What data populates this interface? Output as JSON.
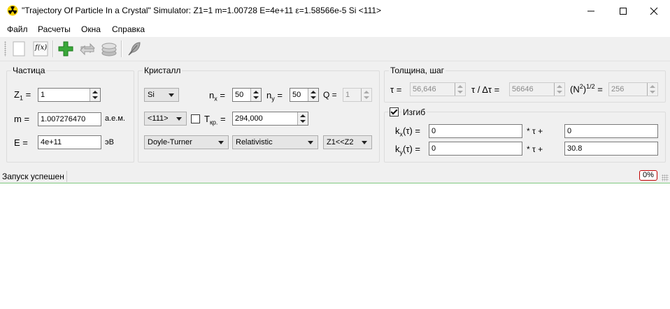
{
  "window": {
    "title": "\"Trajectory Of Particle In a Crystal\" Simulator: Z1=1 m=1.00728 E=4e+11 ε=1.58566e-5 Si <111>",
    "controls": [
      "minimize",
      "maximize",
      "close"
    ]
  },
  "menu": {
    "items": [
      "Файл",
      "Расчеты",
      "Окна",
      "Справка"
    ]
  },
  "toolbar": {
    "buttons": [
      "new-document-icon",
      "function-fx-icon",
      "add-plus-icon",
      "swap-arrows-icon",
      "layers-stack-icon",
      "feather-icon"
    ],
    "fx_label": "f(x)"
  },
  "particle": {
    "title": "Частица",
    "z_label": "Z",
    "z_sub": "1",
    "z_eq": "=",
    "z_value": "1",
    "m_label": "m =",
    "m_value": "1.007276470",
    "m_unit": "а.е.м.",
    "e_label": "E =",
    "e_value": "4e+11",
    "e_unit": "эВ"
  },
  "crystal": {
    "title": "Кристалл",
    "material": "Si",
    "nx_label": "n",
    "nx_sub": "x",
    "nx_eq": "=",
    "nx_value": "50",
    "ny_label": "n",
    "ny_sub": "y",
    "ny_eq": "=",
    "ny_value": "50",
    "q_label": "Q =",
    "q_value": "1",
    "orientation": "<111>",
    "t_label": "T",
    "t_sub": "кр.",
    "t_eq": "=",
    "t_checked": false,
    "t_value": "294,000",
    "potential": "Doyle-Turner",
    "mechanics": "Relativistic",
    "approximation": "Z1<<Z2"
  },
  "thickness": {
    "title": "Толщина, шаг",
    "tau_label": "τ =",
    "tau_value": "56,646",
    "ratio_label": "τ / Δτ =",
    "ratio_value": "56646",
    "n_label_open": "(N",
    "n_sup": "2",
    "n_label_close": ")",
    "n_pow": "1/2",
    "n_eq": "=",
    "n_value": "256"
  },
  "bend": {
    "title": "Изгиб",
    "checked": true,
    "kx_label": "k",
    "kx_sub": "x",
    "kx_rest": "(τ) =",
    "kx_a": "0",
    "kx_mult": "* τ +",
    "kx_b": "0",
    "ky_label": "k",
    "ky_sub": "y",
    "ky_rest": "(τ) =",
    "ky_a": "0",
    "ky_mult": "* τ +",
    "ky_b": "30.8"
  },
  "status": {
    "message": "Запуск успешен",
    "progress_percent": 0,
    "progress_text": "0%"
  },
  "colors": {
    "progress_border": "#c00000",
    "plus_green": "#3aa83a",
    "window_bg": "#f0f0f0"
  }
}
